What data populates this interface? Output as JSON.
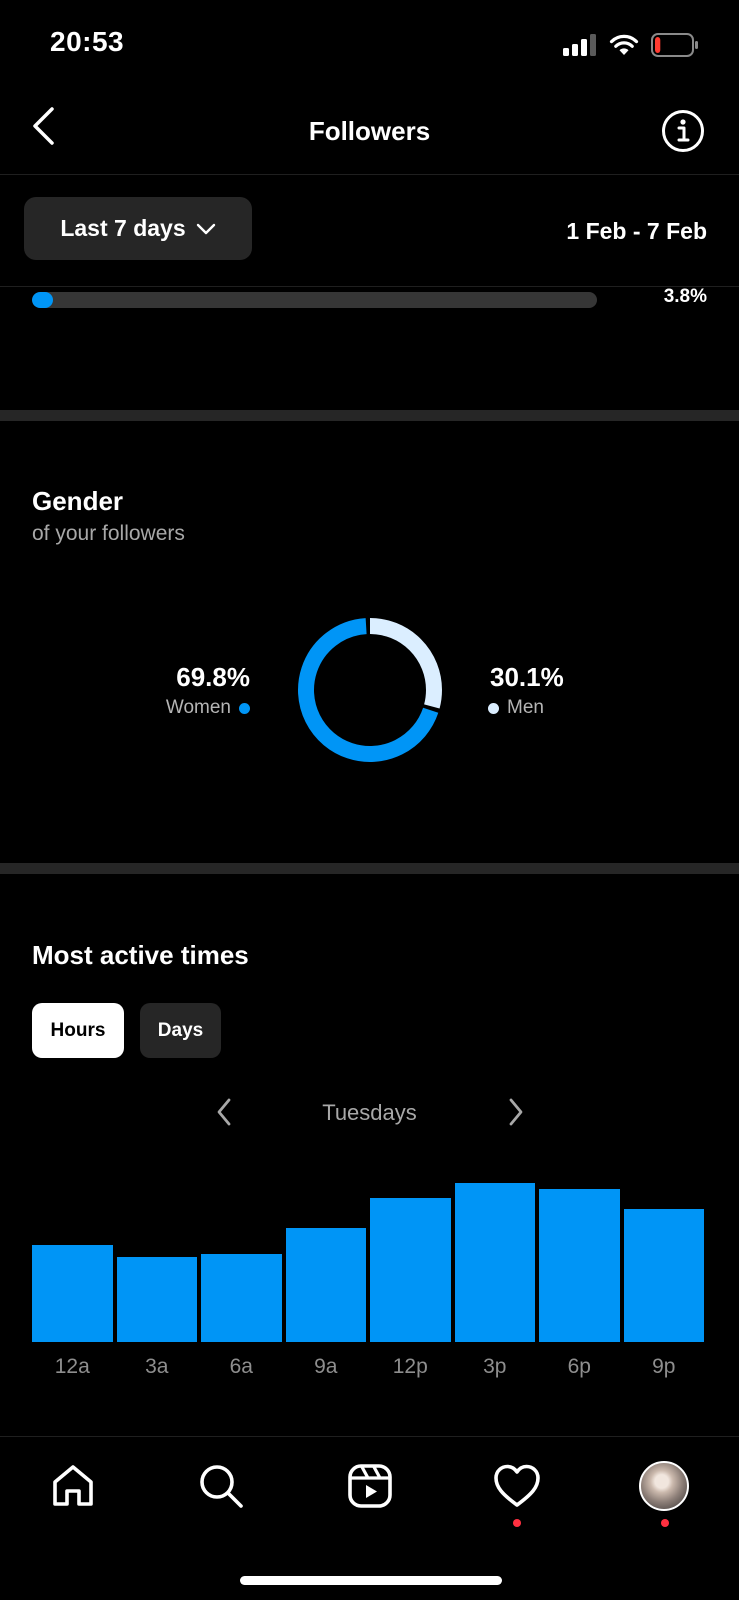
{
  "status_bar": {
    "time": "20:53",
    "battery_level": 0.15,
    "battery_color": "#ff3b30"
  },
  "header": {
    "title": "Followers",
    "back_icon": "chevron-left-icon",
    "info_icon": "info-icon"
  },
  "filters": {
    "range_label": "Last 7 days",
    "range_icon": "chevron-down-icon",
    "date_range": "1 Feb - 7 Feb"
  },
  "progress": {
    "value_pct": 3.8,
    "label": "3.8%"
  },
  "gender": {
    "title": "Gender",
    "subtitle": "of your followers",
    "women": {
      "pct": 69.8,
      "label": "69.8%",
      "name": "Women",
      "color": "#0095f6"
    },
    "men": {
      "pct": 30.1,
      "label": "30.1%",
      "name": "Men",
      "color": "#dbeeff"
    }
  },
  "active_times": {
    "title": "Most active times",
    "tabs": [
      {
        "label": "Hours",
        "selected": true
      },
      {
        "label": "Days",
        "selected": false
      }
    ],
    "day_label": "Tuesdays",
    "prev_icon": "chevron-left-icon",
    "next_icon": "chevron-right-icon"
  },
  "chart_data": {
    "type": "bar",
    "categories": [
      "12a",
      "3a",
      "6a",
      "9a",
      "12p",
      "3p",
      "6p",
      "9p"
    ],
    "values": [
      64,
      56,
      58,
      75,
      95,
      105,
      101,
      88
    ],
    "color": "#0095f6",
    "xlabel": "",
    "ylabel": "",
    "grid": false
  },
  "tab_bar": {
    "items": [
      {
        "name": "home",
        "icon": "home-icon",
        "badge": false
      },
      {
        "name": "search",
        "icon": "search-icon",
        "badge": false
      },
      {
        "name": "reels",
        "icon": "reels-icon",
        "badge": false
      },
      {
        "name": "activity",
        "icon": "heart-icon",
        "badge": true
      },
      {
        "name": "profile",
        "icon": "avatar",
        "badge": true
      }
    ],
    "badge_color": "#ff3040"
  }
}
